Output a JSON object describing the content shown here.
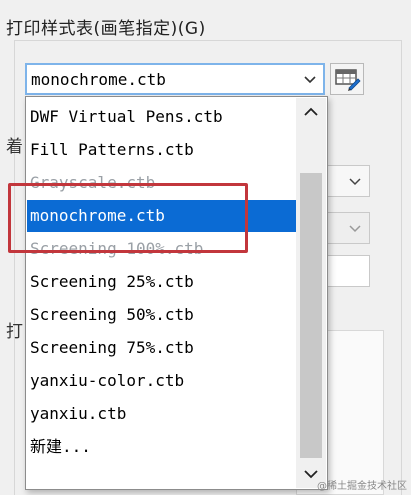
{
  "group": {
    "title": "打印样式表(画笔指定)(G)"
  },
  "combo": {
    "selected": "monochrome.ctb",
    "arrow_icon": "chevron-down-icon"
  },
  "edit_button": {
    "icon": "pen-table-edit-icon"
  },
  "side_labels": {
    "top": "着",
    "bottom": "打"
  },
  "dropdown": {
    "options": [
      "DWF Virtual Pens.ctb",
      "Fill Patterns.ctb",
      "Grayscale.ctb",
      "monochrome.ctb",
      "Screening 100%.ctb",
      "Screening 25%.ctb",
      "Screening 50%.ctb",
      "Screening 75%.ctb",
      "yanxiu-color.ctb",
      "yanxiu.ctb",
      "新建..."
    ],
    "selected_index": 3
  },
  "colors": {
    "selection": "#0b6bd4",
    "highlight_box": "#c2363c",
    "combo_focus": "#7eb4ea"
  },
  "watermark": "@稀土掘金技术社区"
}
